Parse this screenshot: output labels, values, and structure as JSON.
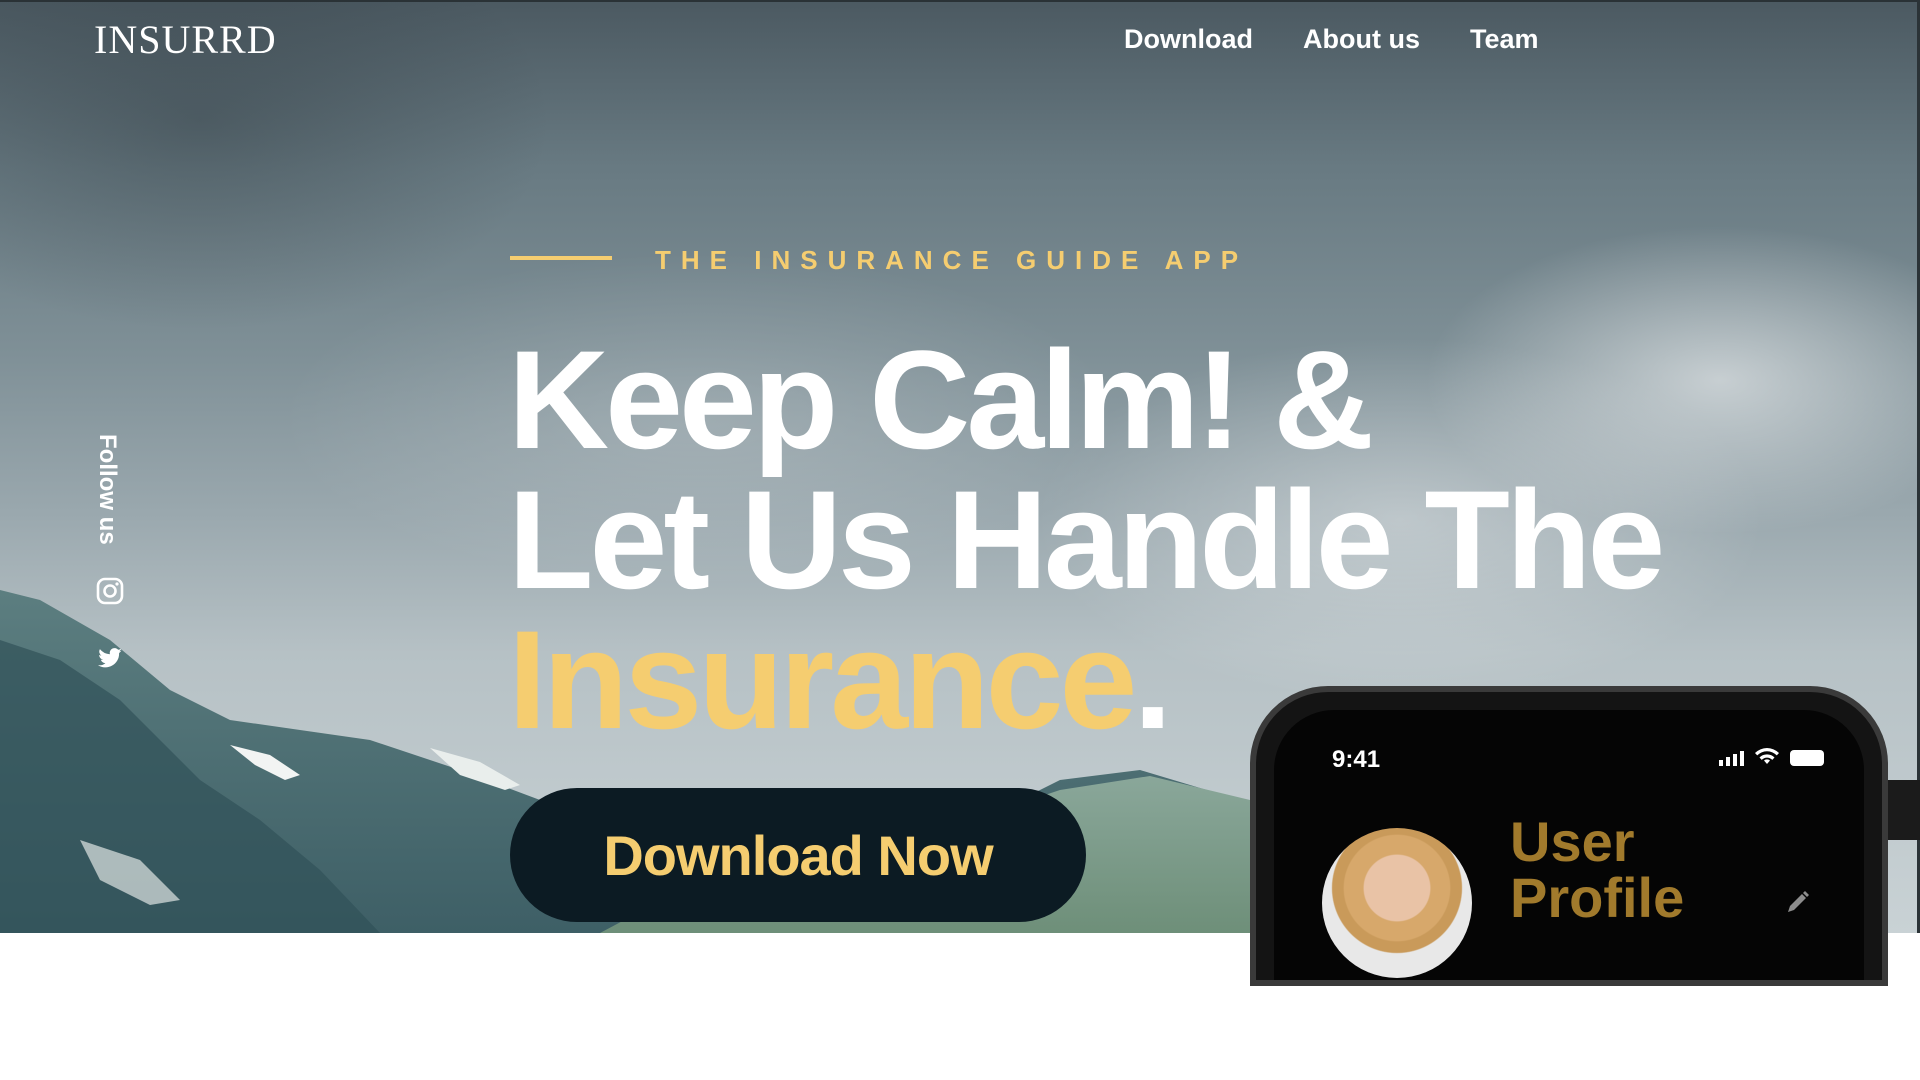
{
  "brand": {
    "logo": "INSURRD"
  },
  "nav": {
    "items": [
      "Download",
      "About us",
      "Team"
    ]
  },
  "social": {
    "label": "Follow us",
    "icons": [
      "instagram-icon",
      "twitter-icon"
    ]
  },
  "hero": {
    "eyebrow": "THE INSURANCE GUIDE APP",
    "line1": "Keep Calm! &",
    "line2": "Let Us Handle The",
    "line3_highlight": "Insurance",
    "line3_end": ".",
    "cta": "Download Now"
  },
  "phone": {
    "time": "9:41",
    "profile_title_1": "User",
    "profile_title_2": "Profile"
  },
  "colors": {
    "accent": "#f5cd70",
    "dark": "#0c1b23"
  }
}
